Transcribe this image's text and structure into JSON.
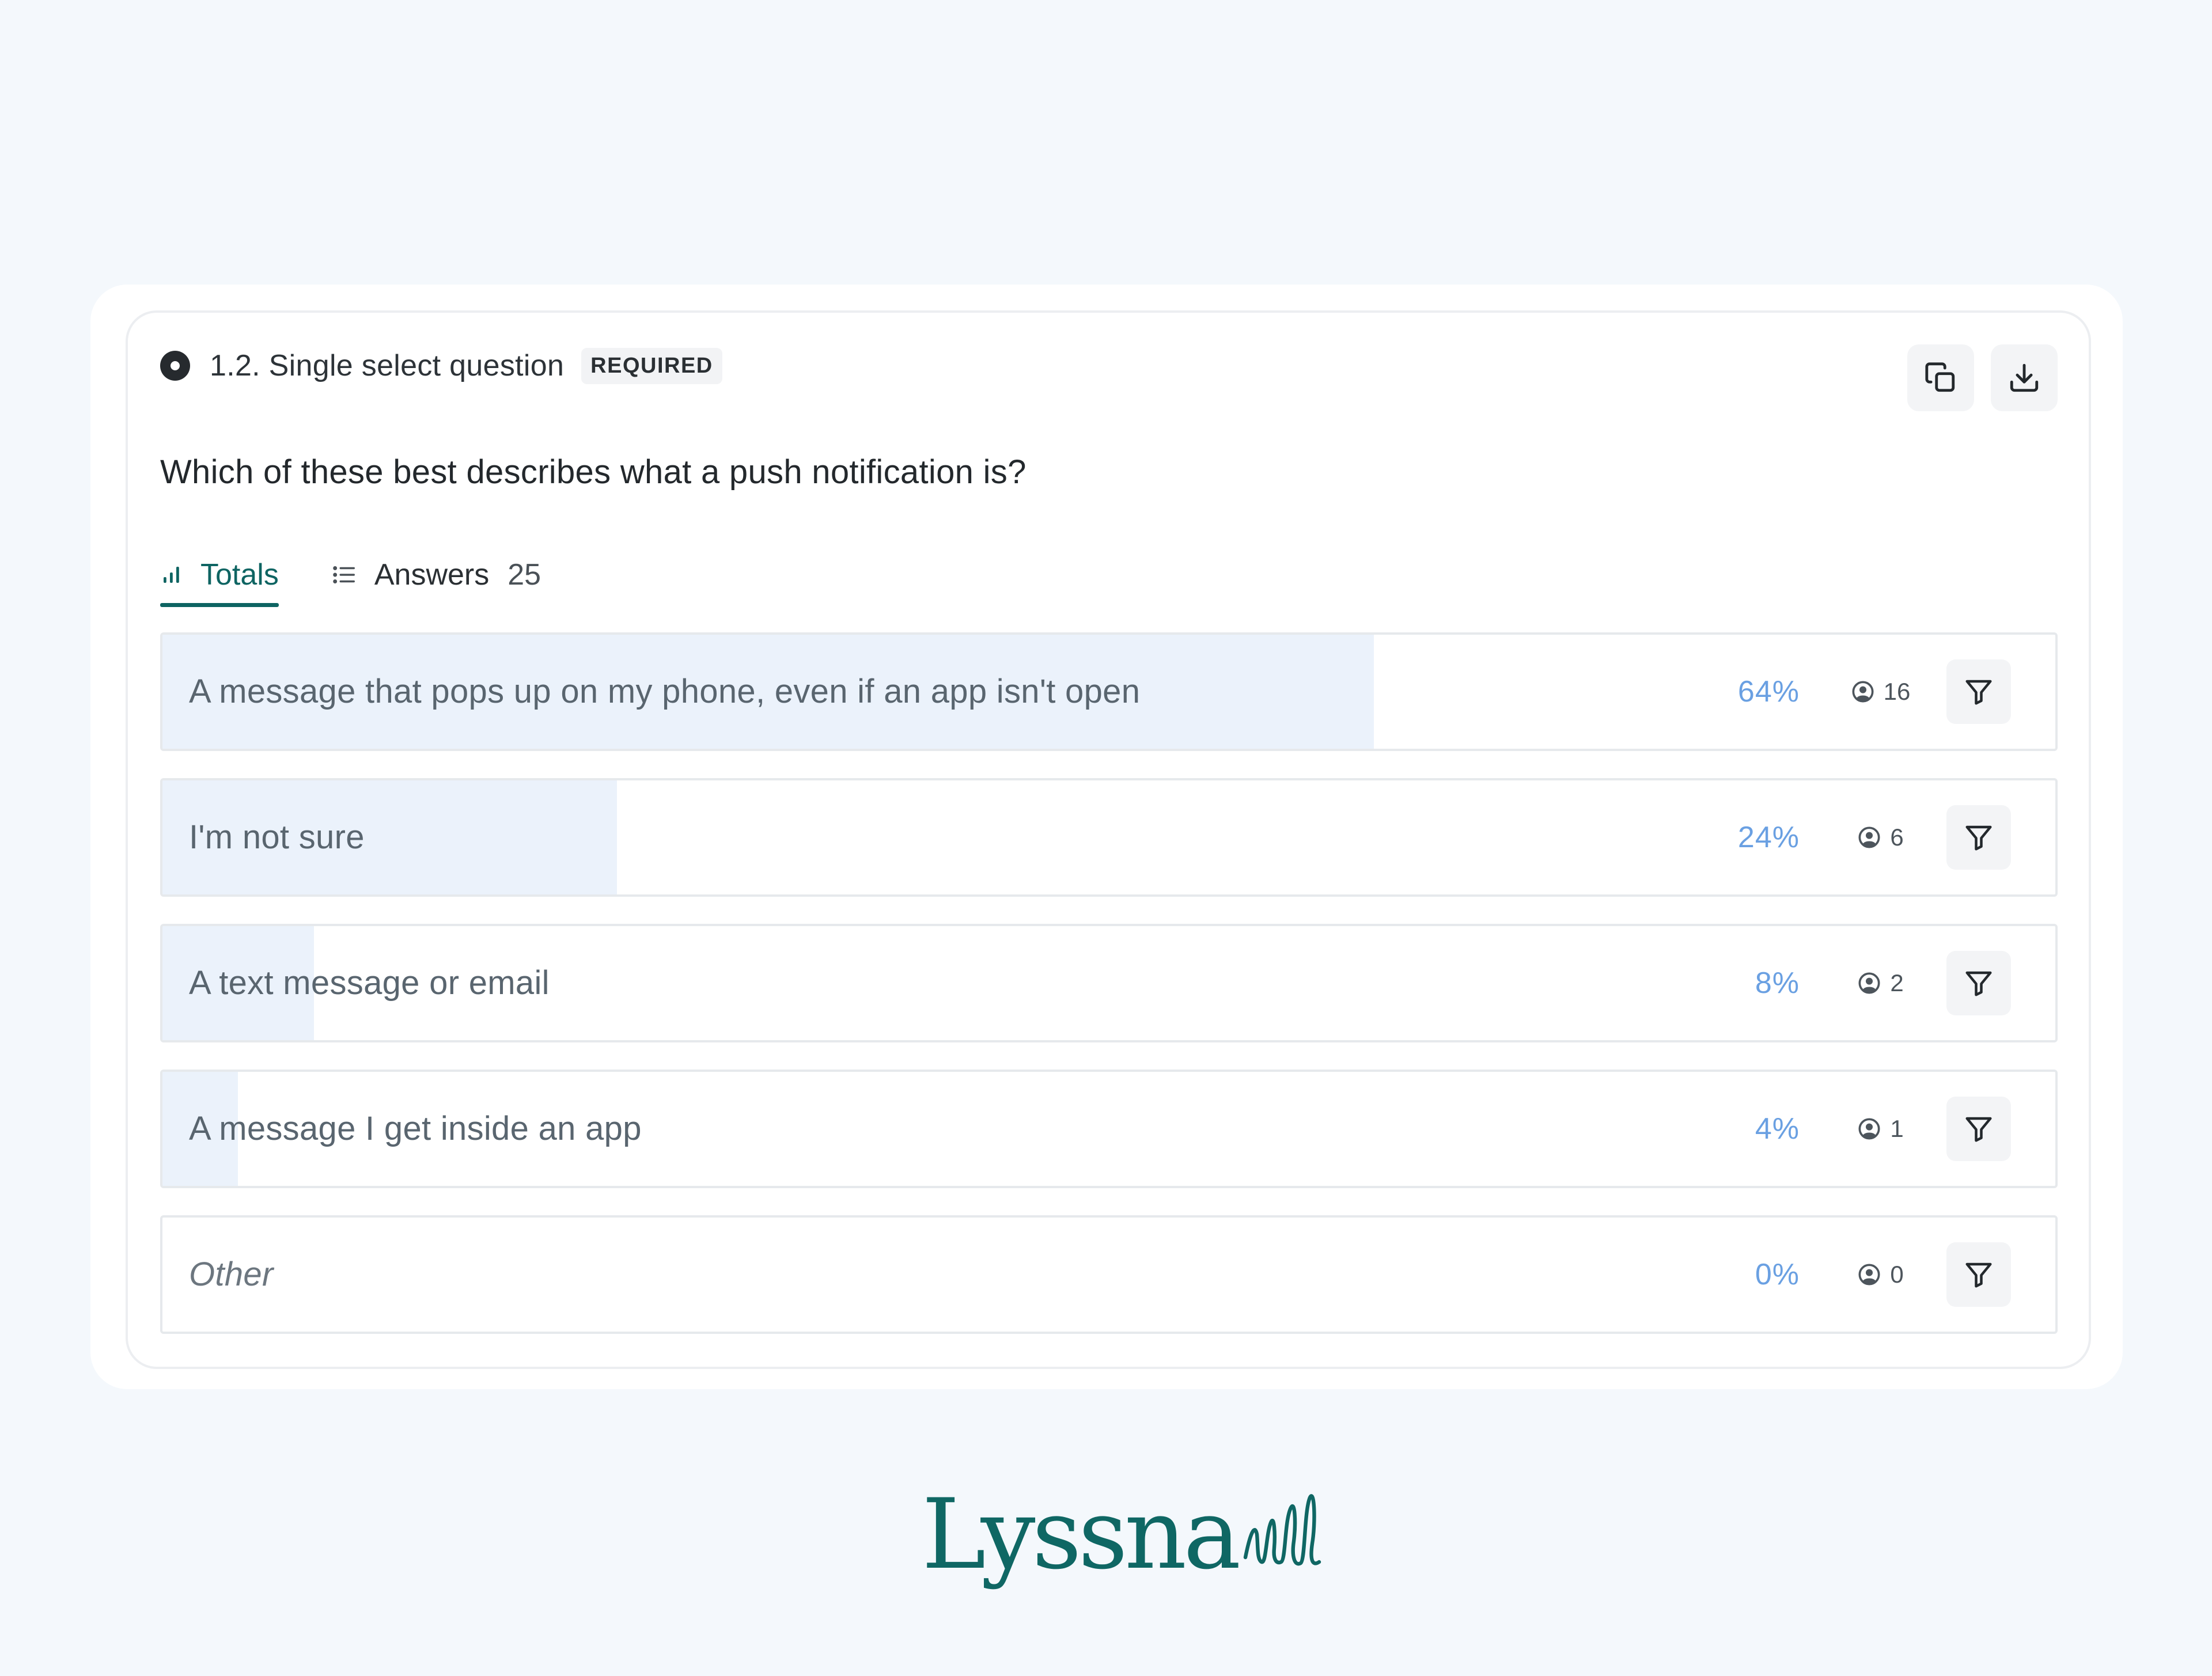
{
  "question": {
    "number_type": "1.2. Single select question",
    "required_label": "REQUIRED",
    "text": "Which of these best describes what a push notification is?"
  },
  "actions": {
    "copy_icon": "copy-icon",
    "download_icon": "download-icon"
  },
  "tabs": [
    {
      "label": "Totals",
      "icon": "bar-chart-icon",
      "active": true
    },
    {
      "label": "Answers",
      "icon": "list-icon",
      "count": "25",
      "active": false
    }
  ],
  "options": [
    {
      "label": "A message that pops up on my phone, even if an app isn't open",
      "percent_text": "64%",
      "percent": 64,
      "count": "16"
    },
    {
      "label": "I'm not sure",
      "percent_text": "24%",
      "percent": 24,
      "count": "6"
    },
    {
      "label": "A text message or email",
      "percent_text": "8%",
      "percent": 8,
      "count": "2"
    },
    {
      "label": "A message I get inside an app",
      "percent_text": "4%",
      "percent": 4,
      "count": "1"
    },
    {
      "label": "Other",
      "percent_text": "0%",
      "percent": 0,
      "count": "0",
      "italic": true
    }
  ],
  "colors": {
    "brand": "#0e6462",
    "bar_fill": "#ebf2fb",
    "percent_text": "#6aa0e2"
  },
  "logo": {
    "text": "Lyssna"
  }
}
